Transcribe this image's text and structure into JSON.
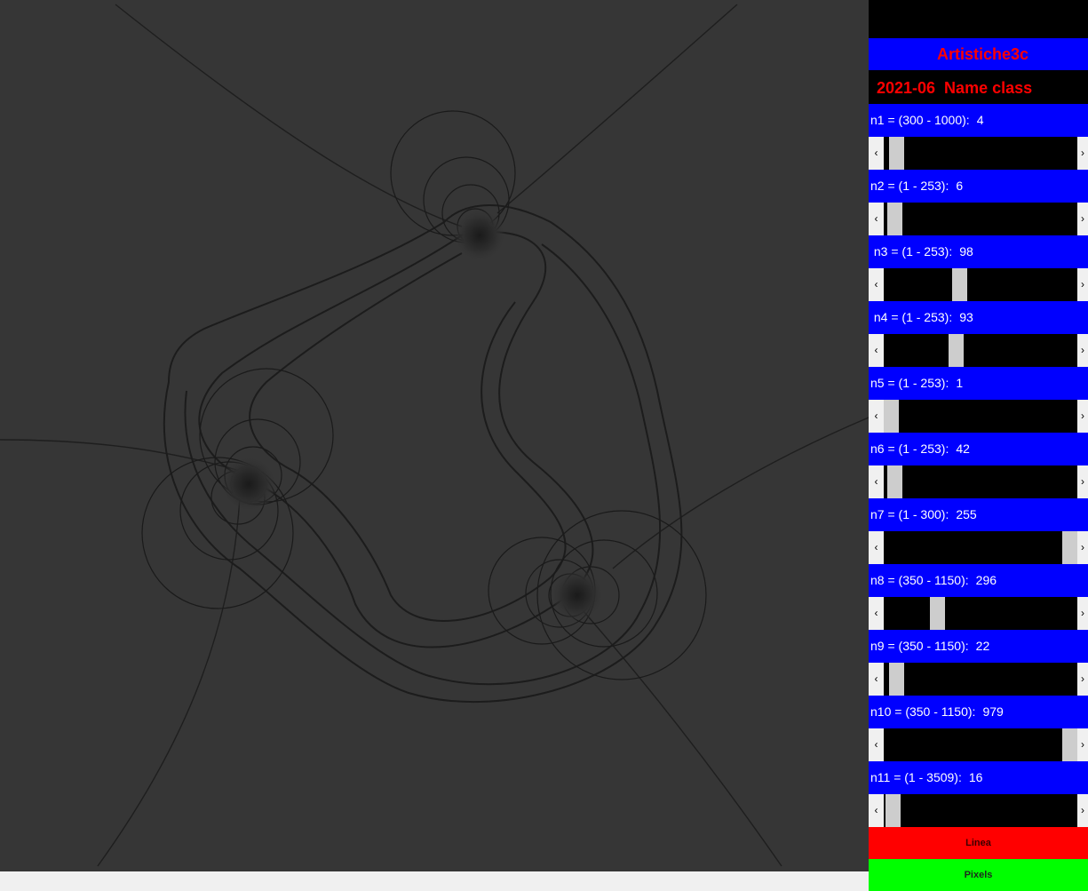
{
  "app": {
    "title": "Artistiche3c",
    "subtitle": "2021-06  Name class"
  },
  "colors": {
    "canvas_background": "#363636",
    "panel_label_bg": "#0000ff",
    "title_text": "#ff0000",
    "linea_button": "#ff0000",
    "pixels_button": "#00ff00"
  },
  "params": [
    {
      "label": "n1 = (300 - 1000):",
      "value": "4",
      "position": 0.03
    },
    {
      "label": "n2 = (1 - 253):",
      "value": "6",
      "position": 0.02
    },
    {
      "label": " n3 = (1 - 253):",
      "value": "98",
      "position": 0.385
    },
    {
      "label": " n4 = (1 - 253):",
      "value": "93",
      "position": 0.365
    },
    {
      "label": "n5 = (1 - 253):",
      "value": "1",
      "position": 0.0
    },
    {
      "label": "n6 = (1 - 253):",
      "value": "42",
      "position": 0.02
    },
    {
      "label": "n7 = (1 - 300):",
      "value": "255",
      "position": 1.0
    },
    {
      "label": "n8 = (350 - 1150):",
      "value": "296",
      "position": 0.26
    },
    {
      "label": "n9 = (350 - 1150):",
      "value": "22",
      "position": 0.03
    },
    {
      "label": "n10 = (350 - 1150):",
      "value": "979",
      "position": 1.0
    },
    {
      "label": "n11 = (1 - 3509):",
      "value": "16",
      "position": 0.01
    }
  ],
  "icons": {
    "scroll_left": "chevron-left-icon",
    "scroll_right": "chevron-right-icon"
  },
  "buttons": {
    "linea": "Linea",
    "pixels": "Pixels"
  }
}
